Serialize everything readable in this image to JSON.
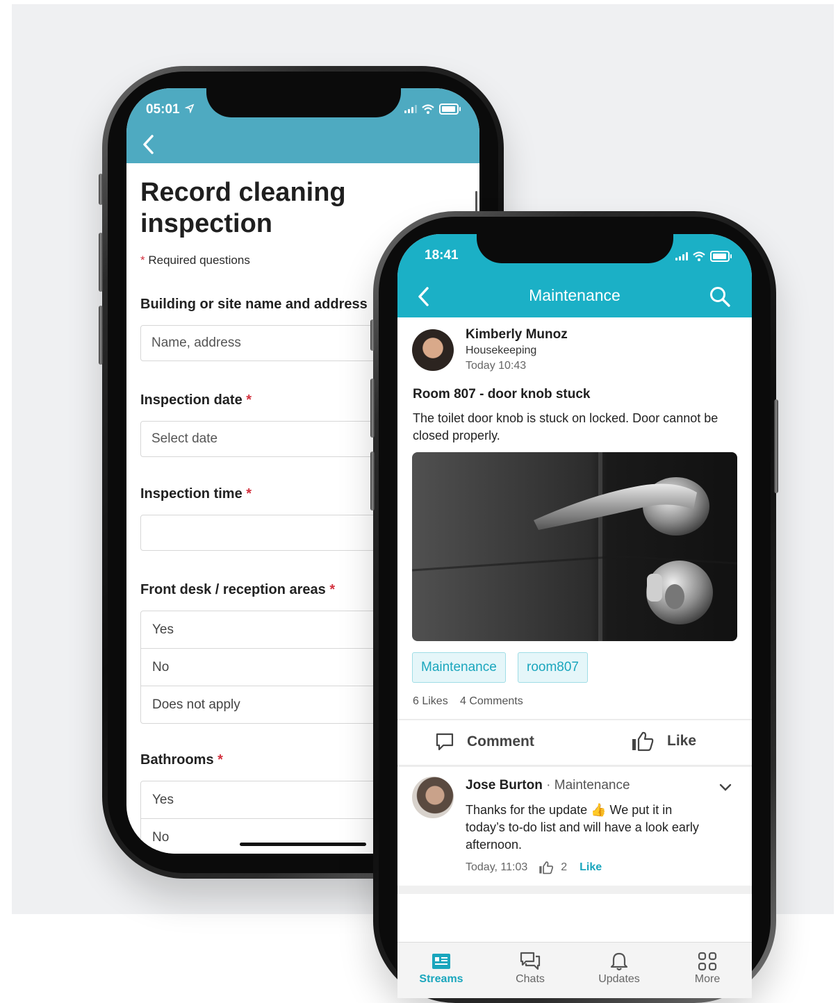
{
  "colors": {
    "back_appbar": "#4eaac1",
    "front_appbar": "#1bb0c6",
    "accent": "#1aa6bd",
    "required": "#d3323f",
    "panel": "#eff0f2"
  },
  "form_screen": {
    "status_time": "05:01",
    "title": "Record cleaning inspection",
    "required_note": "Required questions",
    "required_mark": "*",
    "questions": [
      {
        "label": "Building or site name and address",
        "placeholder": "Name, address"
      },
      {
        "label": "Inspection date",
        "placeholder": "Select date"
      },
      {
        "label": "Inspection time",
        "placeholder": ""
      },
      {
        "label": "Front desk / reception areas",
        "options": [
          "Yes",
          "No",
          "Does not apply"
        ]
      },
      {
        "label": "Bathrooms",
        "options": [
          "Yes",
          "No"
        ]
      }
    ]
  },
  "stream_screen": {
    "status_time": "18:41",
    "title": "Maintenance",
    "post": {
      "author": "Kimberly Munoz",
      "department": "Housekeeping",
      "time": "Today 10:43",
      "title": "Room 807 - door knob stuck",
      "body": "The toilet door knob is stuck on locked. Door cannot be closed properly.",
      "tags": [
        "Maintenance",
        "room807"
      ],
      "likes": "6 Likes",
      "comments": "4 Comments"
    },
    "actions": {
      "comment": "Comment",
      "like": "Like"
    },
    "comment": {
      "author": "Jose Burton",
      "separator": "·",
      "department": "Maintenance",
      "text": "Thanks for the update 👍 We put it in today’s to-do list and will have a look early afternoon.",
      "time": "Today, 11:03",
      "like_count": "2",
      "like_label": "Like"
    },
    "tabs": [
      {
        "label": "Streams",
        "icon": "streams-icon",
        "active": true
      },
      {
        "label": "Chats",
        "icon": "chats-icon",
        "active": false
      },
      {
        "label": "Updates",
        "icon": "bell-icon",
        "active": false
      },
      {
        "label": "More",
        "icon": "grid-icon",
        "active": false
      }
    ]
  }
}
